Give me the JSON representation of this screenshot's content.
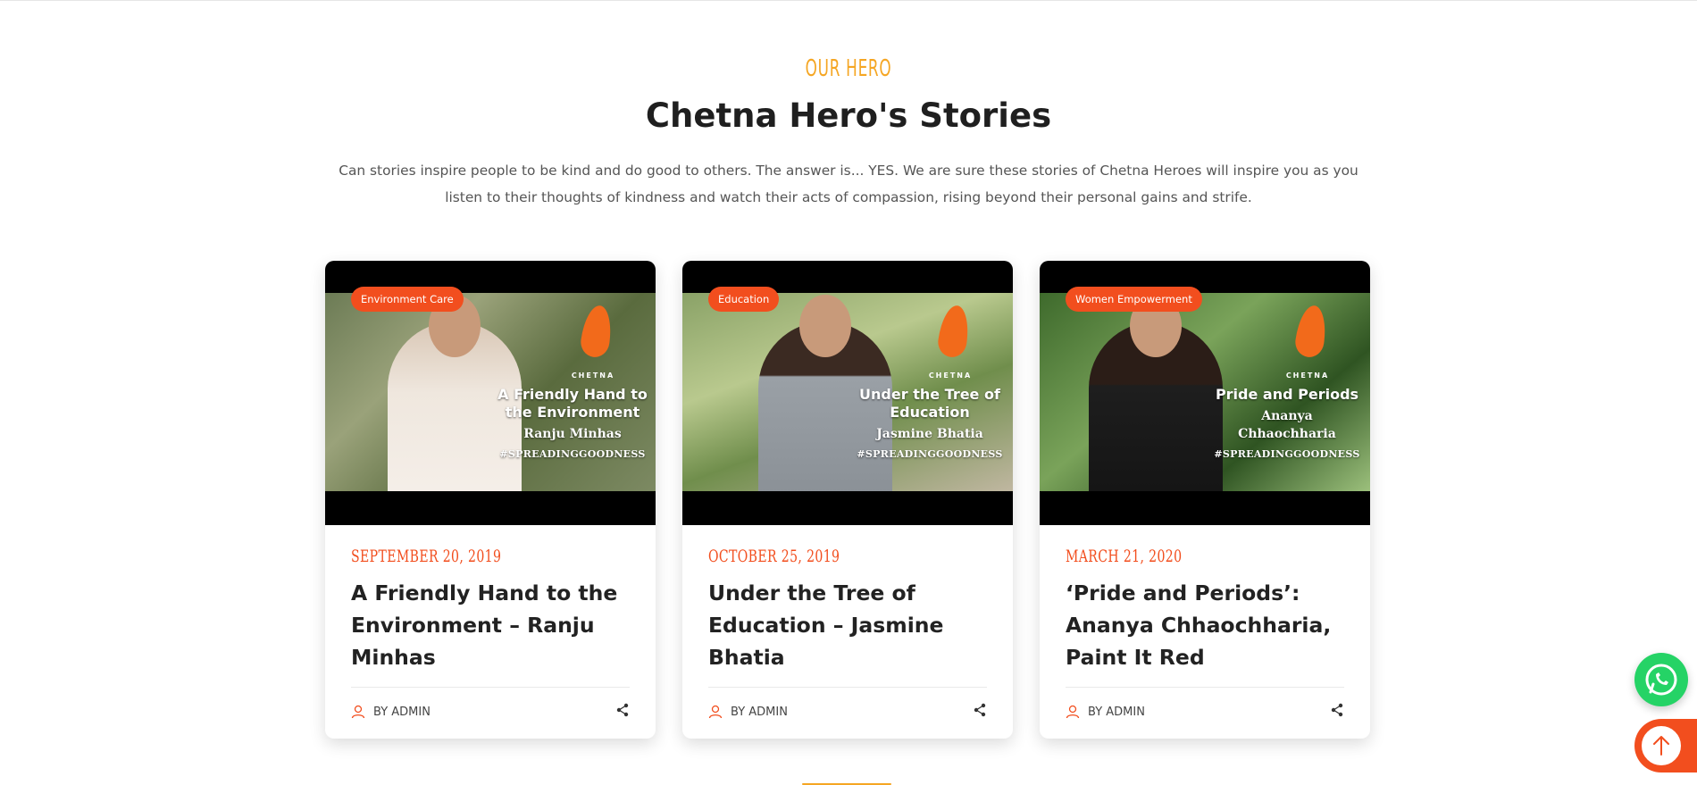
{
  "section": {
    "eyebrow": "OUR HERO",
    "title": "Chetna Hero's Stories",
    "intro": "Can stories inspire people to be kind and do good to others. The answer is... YES. We are sure these stories of Chetna Heroes will inspire you as you listen to their thoughts of kindness and watch their acts of compassion, rising beyond their personal gains and strife."
  },
  "cards": [
    {
      "category": "Environment Care",
      "date": "SEPTEMBER 20, 2019",
      "title": "A Friendly Hand to the Environment – Ranju Minhas",
      "author": "BY ADMIN",
      "video": {
        "brand": "CHETNA",
        "overlay_title": "A Friendly Hand to the Environment",
        "overlay_name": "Ranju Minhas",
        "overlay_tag": "#SPREADINGGOODNESS"
      }
    },
    {
      "category": "Education",
      "date": "OCTOBER 25, 2019",
      "title": "Under the Tree of Education – Jasmine Bhatia",
      "author": "BY ADMIN",
      "video": {
        "brand": "CHETNA",
        "overlay_title": "Under the Tree of Education",
        "overlay_name": "Jasmine Bhatia",
        "overlay_tag": "#SPREADINGGOODNESS"
      }
    },
    {
      "category": "Women Empowerment",
      "date": "MARCH 21, 2020",
      "title": "‘Pride and Periods’: Ananya Chhaochharia, Paint It Red",
      "author": "BY ADMIN",
      "video": {
        "brand": "CHETNA",
        "overlay_title": "Pride and Periods",
        "overlay_name": "Ananya Chhaochharia",
        "overlay_tag": "#SPREADINGGOODNESS"
      }
    }
  ],
  "floating": {
    "whatsapp_icon": "whatsapp-icon",
    "scroll_top_icon": "arrow-up-icon"
  },
  "colors": {
    "accent_orange": "#f24e1e",
    "eyebrow_gold": "#f5a623",
    "whatsapp_green": "#25d366",
    "flame_orange": "#f26a1b"
  }
}
